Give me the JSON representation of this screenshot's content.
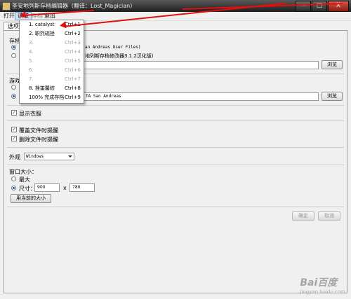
{
  "window": {
    "title": "圣安地列斯存档编辑器（翻译：Lost_Magician）",
    "controls": [
      "—",
      "□",
      "X"
    ]
  },
  "menubar": {
    "items": [
      "打开",
      "读取",
      "存档",
      "退出"
    ]
  },
  "tabs": [
    "选项"
  ],
  "read_menu": {
    "items": [
      {
        "label": "1. catalyst",
        "shortcut": "Ctrl+1",
        "enabled": true
      },
      {
        "label": "2. 职烈砚挫",
        "shortcut": "Ctrl+2",
        "enabled": true
      },
      {
        "label": "3.",
        "shortcut": "Ctrl+3",
        "enabled": false
      },
      {
        "label": "4.",
        "shortcut": "Ctrl+4",
        "enabled": false
      },
      {
        "label": "5.",
        "shortcut": "Ctrl+5",
        "enabled": false
      },
      {
        "label": "6.",
        "shortcut": "Ctrl+6",
        "enabled": false
      },
      {
        "label": "7.",
        "shortcut": "Ctrl+7",
        "enabled": false
      },
      {
        "label": "8. 挫筀馨絞",
        "shortcut": "Ctrl+8",
        "enabled": true
      },
      {
        "label": "100% 完成存档",
        "shortcut": "Ctrl+9",
        "enabled": true
      }
    ]
  },
  "options": {
    "save_location_label": "存档",
    "radio1_text": "an Andreas User Files)",
    "radio2_text": "地列斯存档修改器3.1.2汉化版)",
    "path_browse": "浏览",
    "game_label": "游戏",
    "game_path_value": "TA San Andreas",
    "game_browse": "浏览",
    "show_clothes": "显示衣服",
    "overwrite_prompt": "覆盖文件时提醒",
    "delete_prompt": "删除文件时提醒",
    "appearance_label": "外观",
    "appearance_value": "Windows",
    "window_size_label": "窗口大小：",
    "maximize_label": "最大",
    "size_label": "尺寸：",
    "width_value": "900",
    "by_label": "x",
    "height_value": "780",
    "use_current_size": "用当前的大小",
    "ok": "确定",
    "cancel": "取消"
  },
  "watermark": {
    "main": "Bai百度",
    "sub": "jingyan.baidu.com"
  },
  "colors": {
    "annotation_arrow": "#e01010",
    "titlebar": "#2a2a2a",
    "menu_highlight": "#cfe3f7"
  }
}
